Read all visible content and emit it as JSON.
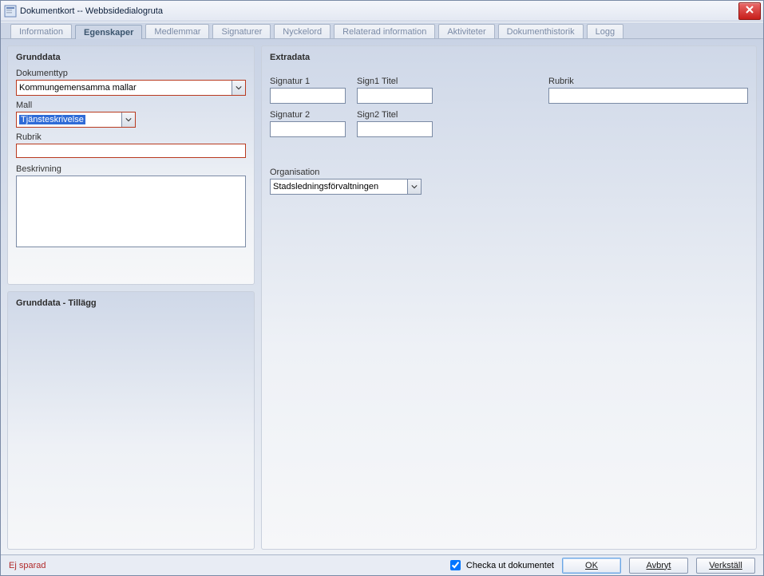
{
  "window": {
    "title": "Dokumentkort -- Webbsidedialogruta"
  },
  "tabs": [
    {
      "label": "Information"
    },
    {
      "label": "Egenskaper",
      "active": true
    },
    {
      "label": "Medlemmar"
    },
    {
      "label": "Signaturer"
    },
    {
      "label": "Nyckelord"
    },
    {
      "label": "Relaterad information"
    },
    {
      "label": "Aktiviteter"
    },
    {
      "label": "Dokumenthistorik"
    },
    {
      "label": "Logg"
    }
  ],
  "grunddata": {
    "title": "Grunddata",
    "dokumenttyp_label": "Dokumenttyp",
    "dokumenttyp_value": "Kommungemensamma mallar",
    "mall_label": "Mall",
    "mall_value": "Tjänsteskrivelse",
    "rubrik_label": "Rubrik",
    "rubrik_value": "",
    "beskrivning_label": "Beskrivning",
    "beskrivning_value": ""
  },
  "grunddata_tillagg": {
    "title": "Grunddata - Tillägg"
  },
  "extradata": {
    "title": "Extradata",
    "signatur1_label": "Signatur 1",
    "signatur1_value": "",
    "sign1titel_label": "Sign1 Titel",
    "sign1titel_value": "",
    "signatur2_label": "Signatur 2",
    "signatur2_value": "",
    "sign2titel_label": "Sign2 Titel",
    "sign2titel_value": "",
    "rubrik_label": "Rubrik",
    "rubrik_value": "",
    "organisation_label": "Organisation",
    "organisation_value": "Stadsledningsförvaltningen"
  },
  "footer": {
    "status": "Ej sparad",
    "checkbox_label": "Checka ut dokumentet",
    "checkbox_checked": true,
    "ok_label": "OK",
    "avbryt_label": "Avbryt",
    "verkstall_label": "Verkställ"
  }
}
